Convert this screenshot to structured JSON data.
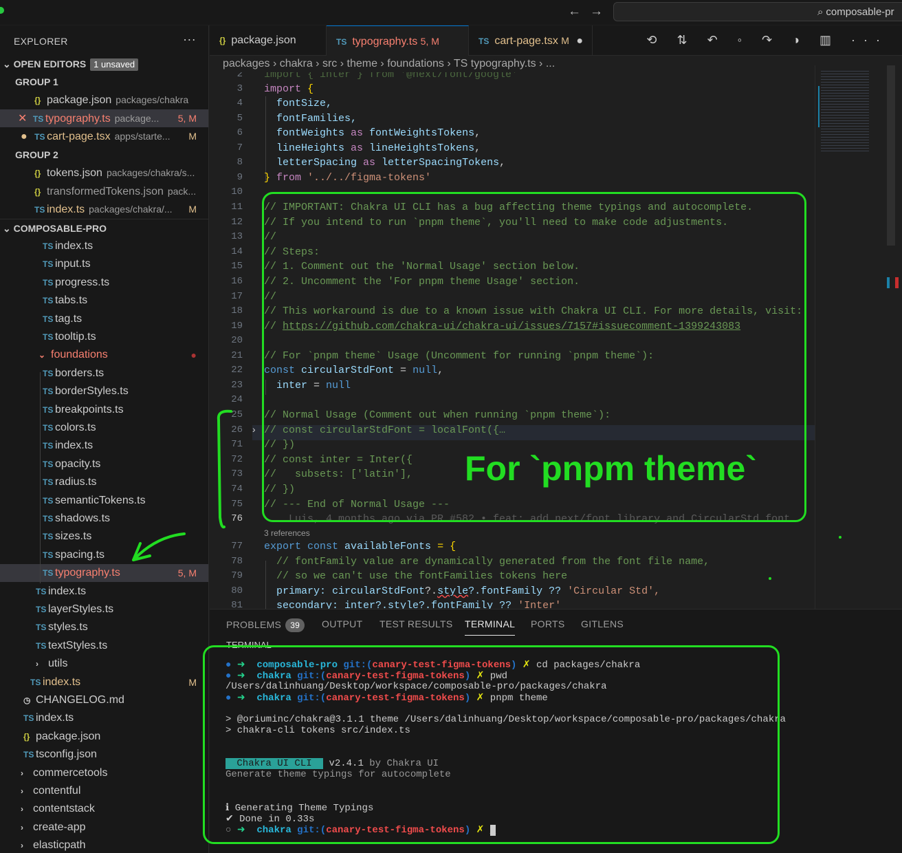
{
  "titlebar": {
    "back": "←",
    "forward": "→",
    "search_text": "composable-pr"
  },
  "explorer": {
    "title": "EXPLORER",
    "more": "···",
    "open_editors": {
      "label": "OPEN EDITORS",
      "badge": "1 unsaved"
    },
    "group1": "GROUP 1",
    "group2": "GROUP 2",
    "open1": [
      {
        "icon": "{}",
        "name": "package.json",
        "desc": "packages/chakra",
        "mark": ""
      },
      {
        "icon": "TS",
        "name": "typography.ts",
        "desc": "package...",
        "mark": "5, M"
      },
      {
        "icon": "TS",
        "name": "cart-page.tsx",
        "desc": "apps/starte...",
        "mark": "M"
      }
    ],
    "open2": [
      {
        "icon": "{}",
        "name": "tokens.json",
        "desc": "packages/chakra/s...",
        "mark": ""
      },
      {
        "icon": "{}",
        "name": "transformedTokens.json",
        "desc": "pack...",
        "mark": ""
      },
      {
        "icon": "TS",
        "name": "index.ts",
        "desc": "packages/chakra/...",
        "mark": "M"
      }
    ],
    "project": "COMPOSABLE-PRO",
    "tree": [
      {
        "icon": "TS",
        "name": "index.ts"
      },
      {
        "icon": "TS",
        "name": "input.ts"
      },
      {
        "icon": "TS",
        "name": "progress.ts"
      },
      {
        "icon": "TS",
        "name": "tabs.ts"
      },
      {
        "icon": "TS",
        "name": "tag.ts"
      },
      {
        "icon": "TS",
        "name": "tooltip.ts"
      },
      {
        "icon": "⌄",
        "name": "foundations"
      },
      {
        "icon": "TS",
        "name": "borders.ts"
      },
      {
        "icon": "TS",
        "name": "borderStyles.ts"
      },
      {
        "icon": "TS",
        "name": "breakpoints.ts"
      },
      {
        "icon": "TS",
        "name": "colors.ts"
      },
      {
        "icon": "TS",
        "name": "index.ts"
      },
      {
        "icon": "TS",
        "name": "opacity.ts"
      },
      {
        "icon": "TS",
        "name": "radius.ts"
      },
      {
        "icon": "TS",
        "name": "semanticTokens.ts"
      },
      {
        "icon": "TS",
        "name": "shadows.ts"
      },
      {
        "icon": "TS",
        "name": "sizes.ts"
      },
      {
        "icon": "TS",
        "name": "spacing.ts"
      },
      {
        "icon": "TS",
        "name": "typography.ts",
        "mark": "5, M"
      },
      {
        "icon": "TS",
        "name": "index.ts"
      },
      {
        "icon": "TS",
        "name": "layerStyles.ts"
      },
      {
        "icon": "TS",
        "name": "styles.ts"
      },
      {
        "icon": "TS",
        "name": "textStyles.ts"
      },
      {
        "icon": "›",
        "name": "utils"
      },
      {
        "icon": "TS",
        "name": "index.ts",
        "mark": "M"
      },
      {
        "icon": "◷",
        "name": "CHANGELOG.md"
      },
      {
        "icon": "TS",
        "name": "index.ts"
      },
      {
        "icon": "{}",
        "name": "package.json"
      },
      {
        "icon": "TS",
        "name": "tsconfig.json"
      },
      {
        "icon": "›",
        "name": "commercetools"
      },
      {
        "icon": "›",
        "name": "contentful"
      },
      {
        "icon": "›",
        "name": "contentstack"
      },
      {
        "icon": "›",
        "name": "create-app"
      },
      {
        "icon": "›",
        "name": "elasticpath"
      }
    ]
  },
  "tabs": [
    {
      "icon": "{}",
      "name": "package.json",
      "status": ""
    },
    {
      "icon": "TS",
      "name": "typography.ts",
      "status": "5, M"
    },
    {
      "icon": "TS",
      "name": "cart-page.tsx",
      "status": "M"
    }
  ],
  "toolbar_icons": "⟲ ⇅ ↶ ◦ ↷ ◑ ▥ ···",
  "breadcrumb": "packages › chakra › src › theme › foundations › TS typography.ts › ...",
  "editor": {
    "line_numbers": [
      "2",
      "3",
      "4",
      "5",
      "6",
      "7",
      "8",
      "9",
      "10",
      "11",
      "12",
      "13",
      "14",
      "15",
      "16",
      "17",
      "18",
      "19",
      "20",
      "21",
      "22",
      "23",
      "24",
      "25",
      "26",
      "71",
      "72",
      "73",
      "74",
      "75",
      "76",
      "",
      "77",
      "78",
      "79",
      "80",
      "81"
    ],
    "lines": {
      "l2": "import { inter } from '@next/font/google'",
      "l3a": "import",
      "l3b": " {",
      "l4": "  fontSize,",
      "l5": "  fontFamilies,",
      "l6a": "  fontWeights",
      "l6b": " as ",
      "l6c": "fontWeightsTokens",
      "l7a": "  lineHeights",
      "l7b": " as ",
      "l7c": "lineHeightsTokens",
      "l8a": "  letterSpacing",
      "l8b": " as ",
      "l8c": "letterSpacingTokens",
      "l9a": "}",
      "l9b": " from ",
      "l9c": "'../../figma-tokens'",
      "l11": "// IMPORTANT: Chakra UI CLI has a bug affecting theme typings and autocomplete.",
      "l12": "// If you intend to run `pnpm theme`, you'll need to make code adjustments.",
      "l13": "//",
      "l14": "// Steps:",
      "l15": "// 1. Comment out the 'Normal Usage' section below.",
      "l16": "// 2. Uncomment the 'For pnpm theme Usage' section.",
      "l17": "//",
      "l18": "// This workaround is due to a known issue with Chakra UI CLI. For more details, visit:",
      "l19a": "// ",
      "l19b": "https://github.com/chakra-ui/chakra-ui/issues/7157#issuecomment-1399243083",
      "l21": "// For `pnpm theme` Usage (Uncomment for running `pnpm theme`):",
      "l22a": "const",
      "l22b": " circularStdFont",
      "l22c": " = ",
      "l22d": "null",
      "l23a": "  inter",
      "l23b": " = ",
      "l23c": "null",
      "l25": "// Normal Usage (Comment out when running `pnpm theme`):",
      "l26": "// const circularStdFont = localFont({…",
      "l71": "// })",
      "l72": "// const inter = Inter({",
      "l73": "//   subsets: ['latin'],",
      "l74": "// })",
      "l75": "// --- End of Normal Usage ---",
      "l76": "    Luis, 4 months ago via PR #582 • feat: add next/font library and CircularStd font",
      "refs": "3 references",
      "l77a": "export",
      "l77b": " const",
      "l77c": " availableFonts",
      "l77d": " = {",
      "l78": "  // fontFamily value are dynamically generated from the font file name,",
      "l79": "  // so we can't use the fontFamilies tokens here",
      "l80a": "  primary:",
      "l80b": " circularStdFont",
      "l80c": "?.",
      "l80d": "style",
      "l80e": "?.fontFamily ?? ",
      "l80f": "'Circular Std',",
      "l81a": "  secondary:",
      "l81b": " inter",
      "l81c": "?.style?.fontFamily ?? ",
      "l81d": "'Inter'"
    }
  },
  "panel": {
    "tabs": [
      {
        "label": "PROBLEMS",
        "count": "39"
      },
      {
        "label": "OUTPUT"
      },
      {
        "label": "TEST RESULTS"
      },
      {
        "label": "TERMINAL"
      },
      {
        "label": "PORTS"
      },
      {
        "label": "GITLENS"
      }
    ],
    "terminal_header": "TERMINAL",
    "lines": {
      "t1_dir": "composable-pro",
      "t1_git": " git:(",
      "t1_br": "canary-test-figma-tokens",
      "t1_cmd": "cd packages/chakra",
      "t2_dir": "chakra",
      "t2_cmd": "pwd",
      "t3": "/Users/dalinhuang/Desktop/workspace/composable-pro/packages/chakra",
      "t4_cmd": "pnpm theme",
      "t5": "> @oriuminc/chakra@3.1.1 theme /Users/dalinhuang/Desktop/workspace/composable-pro/packages/chakra",
      "t6": "> chakra-cli tokens src/index.ts",
      "t7_badge": " Chakra UI CLI ",
      "t7_ver": "v2.4.1",
      "t7_by": " by Chakra UI",
      "t8": "Generate theme typings for autocomplete",
      "t9": "ℹ Generating Theme Typings",
      "t10": "✔ Done in 0.33s"
    }
  },
  "annotation": {
    "label": "For `pnpm theme`",
    "color": "#22dd22"
  }
}
